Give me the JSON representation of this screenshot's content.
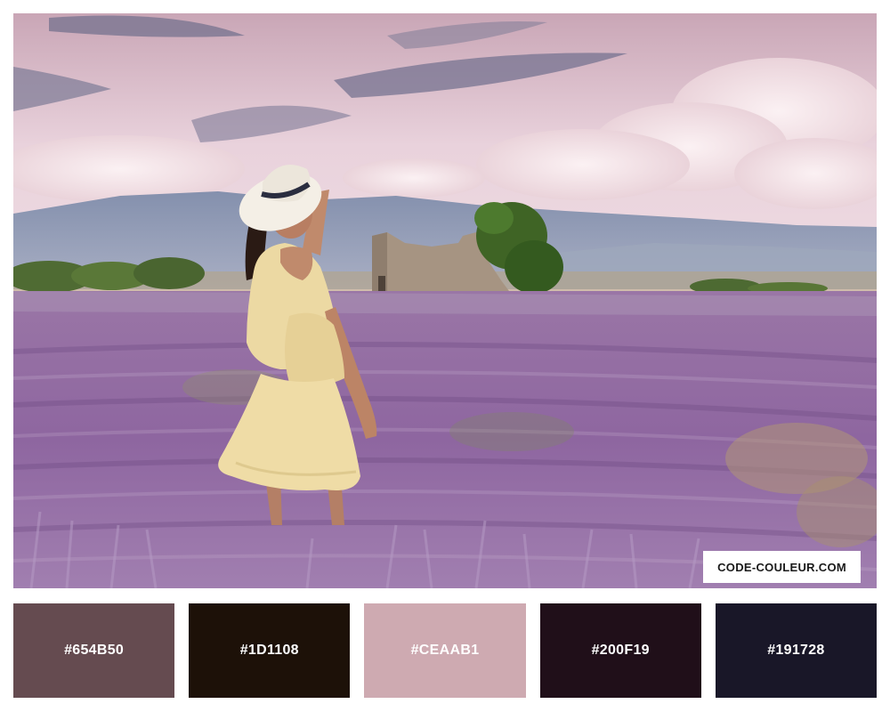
{
  "photo": {
    "subject": "woman-in-lavender-field",
    "watermark": "CODE-COULEUR.COM"
  },
  "palette": [
    {
      "hex": "#654B50",
      "label": "#654B50"
    },
    {
      "hex": "#1D1108",
      "label": "#1D1108"
    },
    {
      "hex": "#CEAAB1",
      "label": "#CEAAB1"
    },
    {
      "hex": "#200F19",
      "label": "#200F19"
    },
    {
      "hex": "#191728",
      "label": "#191728"
    }
  ]
}
